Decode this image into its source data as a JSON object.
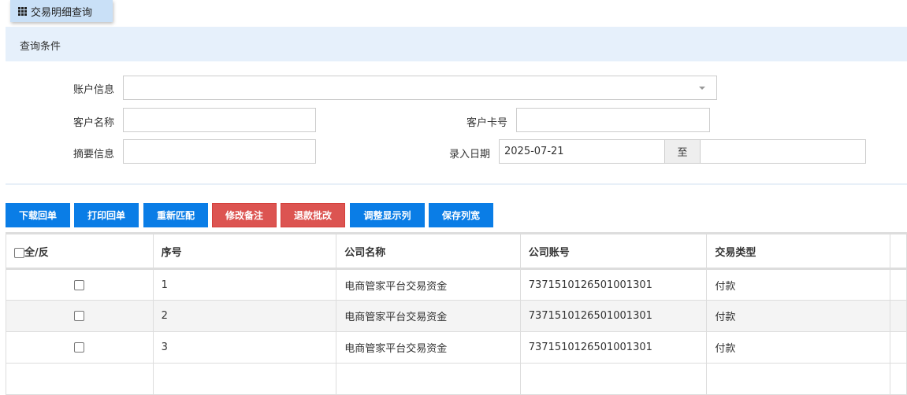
{
  "tab": {
    "title": "交易明细查询"
  },
  "panel": {
    "title": "查询条件"
  },
  "form": {
    "account_info": {
      "label": "账户信息",
      "value": ""
    },
    "customer_name": {
      "label": "客户名称",
      "value": ""
    },
    "card_no": {
      "label": "客户卡号",
      "value": ""
    },
    "summary": {
      "label": "摘要信息",
      "value": ""
    },
    "entry_date": {
      "label": "录入日期",
      "from": "2025-07-21",
      "to_label": "至",
      "to": ""
    }
  },
  "toolbar": [
    "下载回单",
    "打印回单",
    "重新匹配",
    "修改备注",
    "退款批改",
    "调整显示列",
    "保存列宽"
  ],
  "table": {
    "headers": [
      "全/反",
      "序号",
      "公司名称",
      "公司账号",
      "交易类型"
    ],
    "rows": [
      {
        "no": "1",
        "company": "电商管家平台交易资金",
        "account": "7371510126501001301",
        "type": "付款"
      },
      {
        "no": "2",
        "company": "电商管家平台交易资金",
        "account": "7371510126501001301",
        "type": "付款"
      },
      {
        "no": "3",
        "company": "电商管家平台交易资金",
        "account": "7371510126501001301",
        "type": "付款"
      }
    ]
  }
}
